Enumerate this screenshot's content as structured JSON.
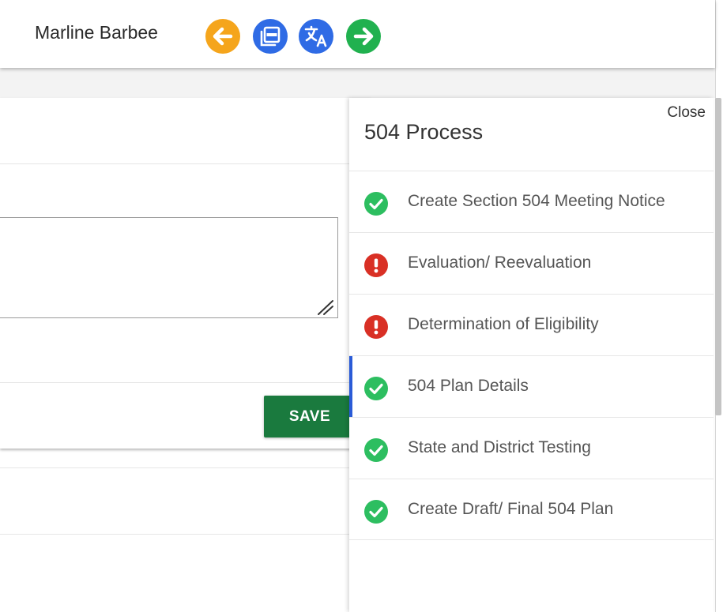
{
  "header": {
    "student_name": "Marline Barbee",
    "buttons": [
      {
        "name": "back",
        "icon": "arrow-left-icon",
        "color": "#F5A51C"
      },
      {
        "name": "pdf",
        "icon": "pdf-icon",
        "color": "#2F6BE5"
      },
      {
        "name": "translate",
        "icon": "translate-icon",
        "color": "#2F6BE5"
      },
      {
        "name": "next",
        "icon": "arrow-right-icon",
        "color": "#21B14F"
      }
    ]
  },
  "form": {
    "save_label": "SAVE",
    "save_color": "#1A7A3E"
  },
  "panel": {
    "close_label": "Close",
    "title": "504 Process",
    "steps": [
      {
        "label": "Create Section 504 Meeting Notice",
        "status": "complete",
        "icon": "check-circle-icon"
      },
      {
        "label": "Evaluation/ Reevaluation",
        "status": "error",
        "icon": "exclamation-circle-icon"
      },
      {
        "label": "Determination of Eligibility",
        "status": "error",
        "icon": "exclamation-circle-icon"
      },
      {
        "label": "504 Plan Details",
        "status": "complete",
        "icon": "check-circle-icon",
        "active": true
      },
      {
        "label": "State and District Testing",
        "status": "complete",
        "icon": "check-circle-icon"
      },
      {
        "label": "Create Draft/ Final 504 Plan",
        "status": "complete",
        "icon": "check-circle-icon"
      }
    ],
    "colors": {
      "complete": "#2DBE60",
      "error": "#D93025",
      "active_indicator": "#2A5BD7"
    }
  }
}
